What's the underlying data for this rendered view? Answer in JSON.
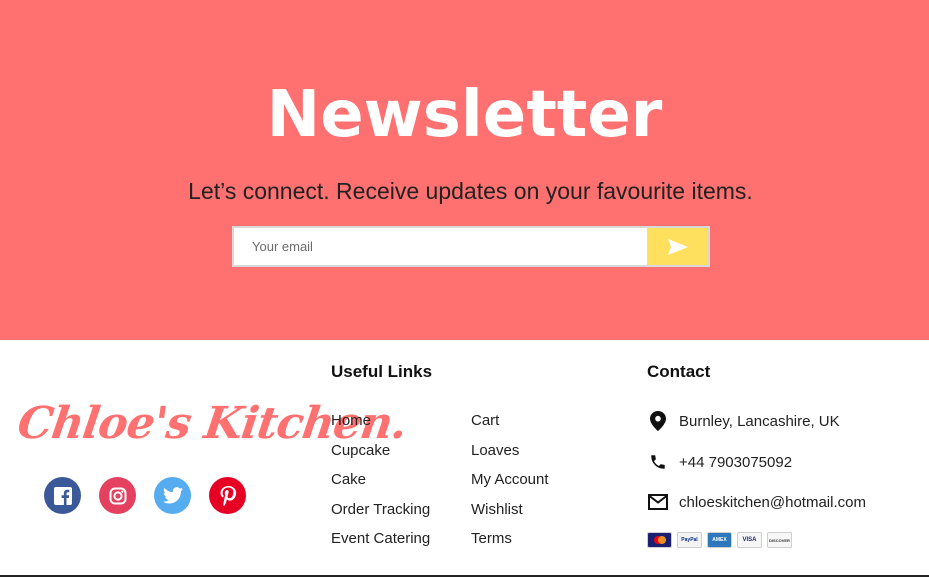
{
  "newsletter": {
    "title": "Newsletter",
    "subtitle": "Let’s connect. Receive updates on your favourite items.",
    "email_placeholder": "Your email",
    "send_icon": "send-icon",
    "colors": {
      "background": "#ff7070",
      "send_button": "#ffdf5e"
    }
  },
  "brand": {
    "logo_text": "Chloe's Kitchen."
  },
  "socials": [
    {
      "name": "facebook",
      "icon": "facebook-icon",
      "color": "#3b5998"
    },
    {
      "name": "instagram",
      "icon": "instagram-icon",
      "color": "#e4405f"
    },
    {
      "name": "twitter",
      "icon": "twitter-icon",
      "color": "#55acee"
    },
    {
      "name": "pinterest",
      "icon": "pinterest-icon",
      "color": "#e60023"
    }
  ],
  "useful_links": {
    "title": "Useful Links",
    "column_1": [
      "Home",
      "Cupcake",
      "Cake",
      "Order Tracking",
      "Event Catering"
    ],
    "column_2": [
      "Cart",
      "Loaves",
      "My Account",
      "Wishlist",
      "Terms"
    ]
  },
  "contact": {
    "title": "Contact",
    "address": "Burnley, Lancashire, UK",
    "phone": "+44 7903075092",
    "email": "chloeskitchen@hotmail.com",
    "payment_methods": [
      "MasterCard",
      "PayPal",
      "American Express",
      "VISA",
      "DISCOVER"
    ]
  }
}
